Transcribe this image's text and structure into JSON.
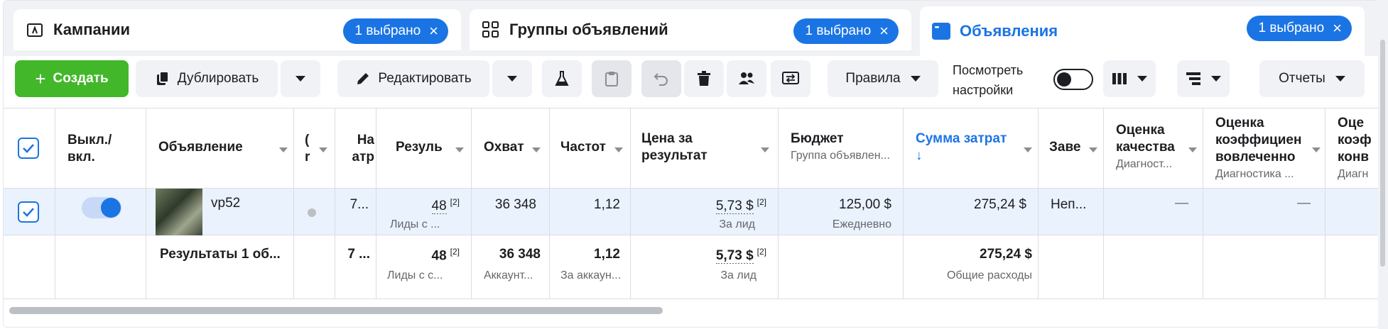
{
  "tabs": [
    {
      "label": "Кампании",
      "pill": "1 выбрано",
      "icon": "campaign-flag-icon"
    },
    {
      "label": "Группы объявлений",
      "pill": "1 выбрано",
      "icon": "grid-icon"
    },
    {
      "label": "Объявления",
      "pill": "1 выбрано",
      "icon": "ad-window-icon",
      "active": true
    }
  ],
  "toolbar": {
    "create": "Создать",
    "duplicate": "Дублировать",
    "edit": "Редактировать",
    "rules": "Правила",
    "view_settings": "Посмотреть настройки",
    "reports": "Отчеты"
  },
  "table": {
    "headers": {
      "onoff": "Выкл./ вкл.",
      "ad": "Объявление",
      "col_c": "(",
      "col_c2": "r",
      "attr": "На атр",
      "results": "Резуль",
      "reach": "Охват",
      "freq": "Частот",
      "cpr": "Цена за результат",
      "budget": "Бюджет",
      "budget_sub": "Группа объявлен...",
      "spent": "Сумма затрат",
      "spent_arrow": "↓",
      "ends": "Заве",
      "quality": "Оценка качества",
      "quality_sub": "Диагност...",
      "engagement": "Оценка коэффициен вовлеченно",
      "engagement_sub": "Диагностика ...",
      "conv": "Оце коэф конв",
      "conv_sub": "Диагн"
    },
    "row": {
      "name": "vp52",
      "attr": "7...",
      "results": "48",
      "results_sup": "[2]",
      "results_sub": "Лиды с ...",
      "reach": "36 348",
      "freq": "1,12",
      "cpr": "5,73 $",
      "cpr_sup": "[2]",
      "cpr_sub": "За лид",
      "budget": "125,00 $",
      "budget_sub": "Ежедневно",
      "spent": "275,24 $",
      "ends": "Неп...",
      "quality": "—",
      "engagement": "—"
    },
    "totals": {
      "label": "Результаты 1 об...",
      "attr": "7 ...",
      "results": "48",
      "results_sup": "[2]",
      "results_sub": "Лиды с с...",
      "reach": "36 348",
      "reach_sub": "Аккаунт...",
      "freq": "1,12",
      "freq_sub": "За аккаун...",
      "cpr": "5,73 $",
      "cpr_sup": "[2]",
      "cpr_sub": "За лид",
      "spent": "275,24 $",
      "spent_sub": "Общие расходы"
    }
  },
  "colors": {
    "accent": "#1b74e4",
    "create": "#42b72a",
    "row_selected": "#eaf2fd"
  }
}
